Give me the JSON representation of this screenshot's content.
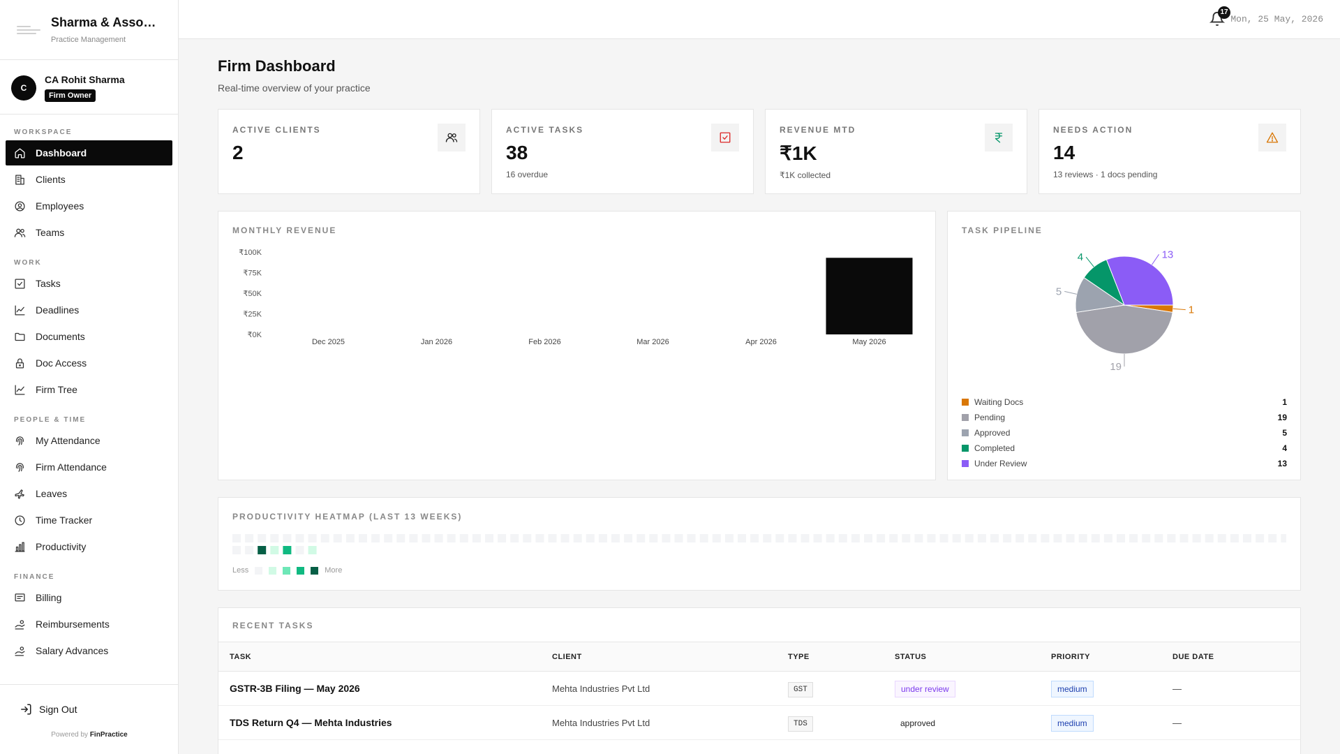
{
  "brand": {
    "name": "Sharma & Associates",
    "subtitle": "Practice Management"
  },
  "user": {
    "initial": "C",
    "name": "CA Rohit Sharma",
    "role": "Firm Owner"
  },
  "nav": {
    "sections": [
      {
        "title": "WORKSPACE",
        "items": [
          {
            "label": "Dashboard",
            "icon": "home-icon",
            "active": true
          },
          {
            "label": "Clients",
            "icon": "building-icon"
          },
          {
            "label": "Employees",
            "icon": "user-circle-icon"
          },
          {
            "label": "Teams",
            "icon": "users-icon"
          }
        ]
      },
      {
        "title": "WORK",
        "items": [
          {
            "label": "Tasks",
            "icon": "check-square-icon"
          },
          {
            "label": "Deadlines",
            "icon": "chart-line-icon"
          },
          {
            "label": "Documents",
            "icon": "folder-icon"
          },
          {
            "label": "Doc Access",
            "icon": "lock-icon"
          },
          {
            "label": "Firm Tree",
            "icon": "chart-line-icon"
          }
        ]
      },
      {
        "title": "PEOPLE & TIME",
        "items": [
          {
            "label": "My Attendance",
            "icon": "fingerprint-icon"
          },
          {
            "label": "Firm Attendance",
            "icon": "fingerprint-icon"
          },
          {
            "label": "Leaves",
            "icon": "plane-icon"
          },
          {
            "label": "Time Tracker",
            "icon": "clock-icon"
          },
          {
            "label": "Productivity",
            "icon": "bar-chart-icon"
          }
        ]
      },
      {
        "title": "FINANCE",
        "items": [
          {
            "label": "Billing",
            "icon": "receipt-icon"
          },
          {
            "label": "Reimbursements",
            "icon": "hand-coins-icon"
          },
          {
            "label": "Salary Advances",
            "icon": "hand-coins-icon"
          }
        ]
      }
    ]
  },
  "footer": {
    "signout": "Sign Out",
    "powered_prefix": "Powered by",
    "powered_brand": "FinPractice"
  },
  "topbar": {
    "notification_count": "17",
    "date": "Mon, 25 May, 2026"
  },
  "page": {
    "title": "Firm Dashboard",
    "subtitle": "Real-time overview of your practice"
  },
  "kpis": [
    {
      "label": "ACTIVE CLIENTS",
      "value": "2",
      "sub": "",
      "icon": "users-icon",
      "icon_color": "#222222"
    },
    {
      "label": "ACTIVE TASKS",
      "value": "38",
      "sub": "16 overdue",
      "icon": "check-square-icon",
      "icon_color": "#dc2626"
    },
    {
      "label": "REVENUE MTD",
      "value": "₹1K",
      "sub": "₹1K collected",
      "icon": "rupee-icon",
      "icon_color": "#059669"
    },
    {
      "label": "NEEDS ACTION",
      "value": "14",
      "sub": "13 reviews · 1 docs pending",
      "icon": "alert-triangle-icon",
      "icon_color": "#d97706"
    }
  ],
  "revenue": {
    "title": "MONTHLY REVENUE",
    "chart_data": {
      "type": "bar",
      "categories": [
        "Dec 2025",
        "Jan 2026",
        "Feb 2026",
        "Mar 2026",
        "Apr 2026",
        "May 2026"
      ],
      "values": [
        0,
        0,
        0,
        0,
        0,
        93000
      ],
      "yticks": [
        "₹0K",
        "₹25K",
        "₹50K",
        "₹75K",
        "₹100K"
      ],
      "ylim": [
        0,
        100000
      ],
      "bar_color": "#0a0a0a",
      "grid": false
    }
  },
  "pipeline": {
    "title": "TASK PIPELINE",
    "chart_data": {
      "type": "pie",
      "labels": [
        "Waiting Docs",
        "Pending",
        "Approved",
        "Completed",
        "Under Review"
      ],
      "values": [
        1,
        19,
        5,
        4,
        13
      ],
      "colors": [
        "#d97706",
        "#a1a1aa",
        "#9ca3af",
        "#059669",
        "#8b5cf6"
      ]
    }
  },
  "heatmap": {
    "title": "PRODUCTIVITY HEATMAP (LAST 13 WEEKS)",
    "legend_less": "Less",
    "legend_more": "More",
    "scale": [
      "#f3f4f6",
      "#d1fae5",
      "#6ee7b7",
      "#10b981",
      "#065f46"
    ],
    "row1_levels": [
      0,
      0,
      0,
      0,
      0,
      0,
      0,
      0,
      0,
      0,
      0,
      0,
      0,
      0,
      0,
      0,
      0,
      0,
      0,
      0,
      0,
      0,
      0,
      0,
      0,
      0,
      0,
      0,
      0,
      0,
      0,
      0,
      0,
      0,
      0,
      0,
      0,
      0,
      0,
      0,
      0,
      0,
      0,
      0,
      0,
      0,
      0,
      0,
      0,
      0,
      0,
      0,
      0,
      0,
      0,
      0,
      0,
      0,
      0,
      0,
      0,
      0,
      0,
      0,
      0,
      0,
      0,
      0,
      0,
      0,
      0,
      0,
      0,
      0,
      0,
      0,
      0,
      0,
      0,
      0,
      0,
      0,
      0,
      0
    ],
    "row2_levels": [
      0,
      0,
      4,
      1,
      3,
      0,
      1
    ]
  },
  "tasks": {
    "title": "RECENT TASKS",
    "columns": [
      "TASK",
      "CLIENT",
      "TYPE",
      "STATUS",
      "PRIORITY",
      "DUE DATE"
    ],
    "rows": [
      {
        "task": "GSTR-3B Filing — May 2026",
        "client": "Mehta Industries Pvt Ltd",
        "type": "GST",
        "status": "under review",
        "priority": "medium",
        "due": "—"
      },
      {
        "task": "TDS Return Q4 — Mehta Industries",
        "client": "Mehta Industries Pvt Ltd",
        "type": "TDS",
        "status": "approved",
        "priority": "medium",
        "due": "—"
      }
    ]
  }
}
